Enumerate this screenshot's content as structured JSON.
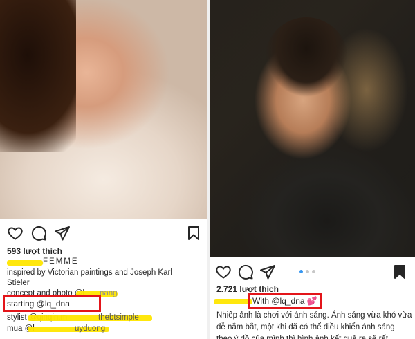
{
  "colors": {
    "highlight": "#ffe600",
    "annotation_box": "#e3151a",
    "carousel_active": "#3897f0"
  },
  "left_post": {
    "icons": [
      "heart-icon",
      "comment-icon",
      "share-icon",
      "bookmark-icon"
    ],
    "likes": "593 lượt thích",
    "caption_lines": {
      "title": "FEMME",
      "line2": "inspired by Victorian paintings and Joseph Karl",
      "line3": "Stieler",
      "line4": "concept and photo @l",
      "line4_tail": "nang",
      "starting": "starting @lq_dna",
      "stylist": "stylist @qinqin.m",
      "stylist_tail": "thebtsimple",
      "mua": "mua @l",
      "mua_tail": "uyduong"
    }
  },
  "right_post": {
    "icons": [
      "heart-icon",
      "comment-icon",
      "share-icon",
      "bookmark-icon"
    ],
    "carousel_dots": 3,
    "likes": "2.721 lượt thích",
    "with_text": "With @lq_dna 💕",
    "caption": "Nhiếp ảnh là chơi với ánh sáng. Ánh sáng vừa khó vừa dễ nắm bắt, một khi đã có thể điều khiển ánh sáng theo ý đồ của mình thì hình ảnh kết quả ra sẽ rất"
  }
}
